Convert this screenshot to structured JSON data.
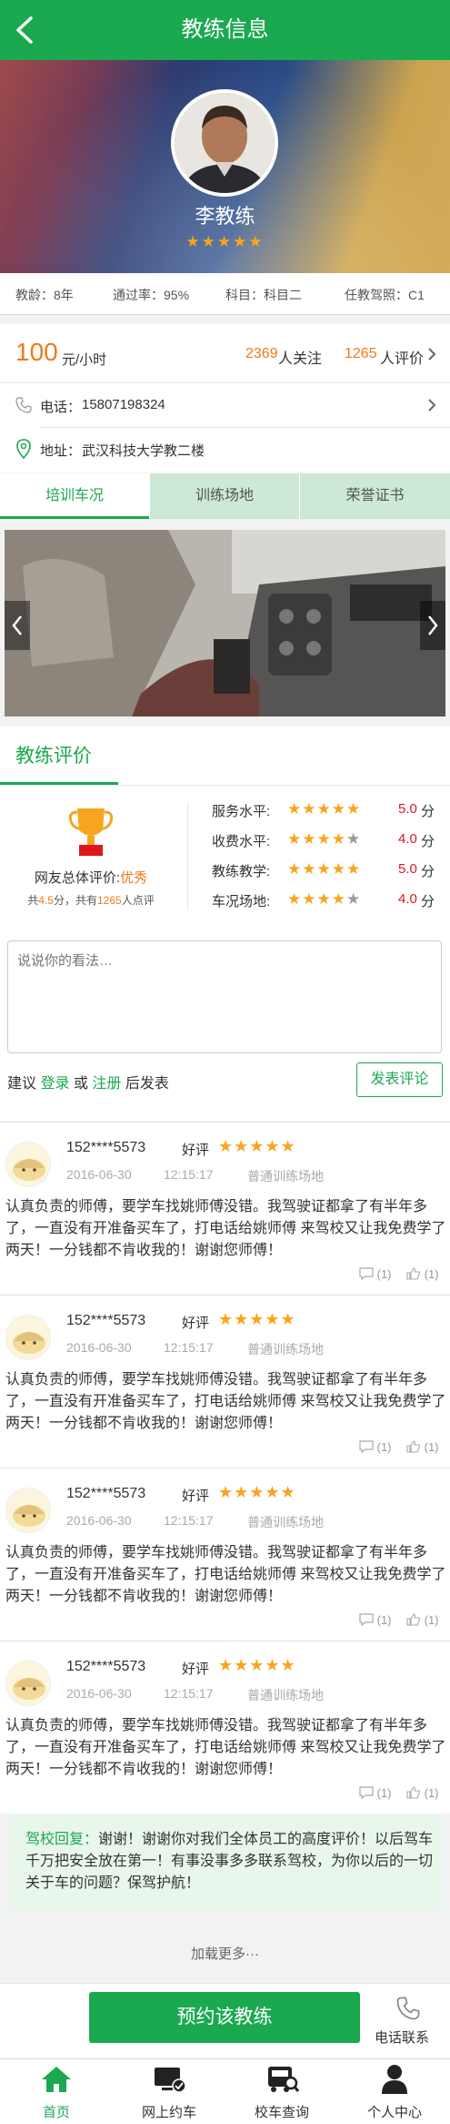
{
  "header": {
    "title": "教练信息"
  },
  "coach": {
    "name": "李教练",
    "stars": "★★★★★"
  },
  "stats": {
    "age": "教龄：8年",
    "pass_rate": "通过率：95%",
    "subject": "科目：科目二",
    "license": "任教驾照：C1"
  },
  "pricing": {
    "price": "100",
    "unit": "元/小时",
    "followers": "2369",
    "followers_label": "人关注",
    "evaluations": "1265",
    "evaluations_label": "人评价"
  },
  "contact": {
    "phone_label": "电话：",
    "phone": "15807198324",
    "address_label": "地址：",
    "address": "武汉科技大学教二楼"
  },
  "tabs": [
    "培训车况",
    "训练场地",
    "荣誉证书"
  ],
  "reviews_section": {
    "title": "教练评价",
    "overall_label": "网友总体评价:",
    "overall_value": "优秀",
    "summary_total": "共",
    "summary_score": "4.5",
    "summary_mid": "分，共有",
    "summary_count": "1265",
    "summary_end": "人点评",
    "scores": [
      {
        "label": "服务水平:",
        "stars": "★★★★★",
        "value": "5.0",
        "unit": "分",
        "filled": 5
      },
      {
        "label": "收费水平:",
        "stars": "★★★★★",
        "value": "4.0",
        "unit": "分",
        "filled": 4
      },
      {
        "label": "教练教学:",
        "stars": "★★★★★",
        "value": "5.0",
        "unit": "分",
        "filled": 5
      },
      {
        "label": "车况场地:",
        "stars": "★★★★★",
        "value": "4.0",
        "unit": "分",
        "filled": 4
      }
    ]
  },
  "comment_box": {
    "placeholder": "说说你的看法…",
    "hint_prefix": "建议",
    "login": "登录",
    "or": "或",
    "register": "注册",
    "hint_suffix": "后发表",
    "publish": "发表评论"
  },
  "reviews": [
    {
      "user": "152****5573",
      "tag": "好评",
      "stars": "★★★★★",
      "date": "2016-06-30",
      "time": "12:15:17",
      "site": "普通训练场地",
      "body": "认真负责的师傅，要学车找姚师傅没错。我驾驶证都拿了有半年多了，一直没有开准备买车了，打电话给姚师傅 来驾校又让我免费学了两天！一分钱都不肯收我的！谢谢您师傅！",
      "replies": "(1)",
      "likes": "(1)"
    },
    {
      "user": "152****5573",
      "tag": "好评",
      "stars": "★★★★★",
      "date": "2016-06-30",
      "time": "12:15:17",
      "site": "普通训练场地",
      "body": "认真负责的师傅，要学车找姚师傅没错。我驾驶证都拿了有半年多了，一直没有开准备买车了，打电话给姚师傅 来驾校又让我免费学了两天！一分钱都不肯收我的！谢谢您师傅！",
      "replies": "(1)",
      "likes": "(1)"
    },
    {
      "user": "152****5573",
      "tag": "好评",
      "stars": "★★★★★",
      "date": "2016-06-30",
      "time": "12:15:17",
      "site": "普通训练场地",
      "body": "认真负责的师傅，要学车找姚师傅没错。我驾驶证都拿了有半年多了，一直没有开准备买车了，打电话给姚师傅 来驾校又让我免费学了两天！一分钱都不肯收我的！谢谢您师傅！",
      "replies": "(1)",
      "likes": "(1)"
    },
    {
      "user": "152****5573",
      "tag": "好评",
      "stars": "★★★★★",
      "date": "2016-06-30",
      "time": "12:15:17",
      "site": "普通训练场地",
      "body": "认真负责的师傅，要学车找姚师傅没错。我驾驶证都拿了有半年多了，一直没有开准备买车了，打电话给姚师傅 来驾校又让我免费学了两天！一分钱都不肯收我的！谢谢您师傅！",
      "replies": "(1)",
      "likes": "(1)"
    }
  ],
  "school_reply": {
    "label": "驾校回复：",
    "text": "谢谢！谢谢你对我们全体员工的高度评价！以后驾车千万把安全放在第一！有事没事多多联系驾校，为你以后的一切关于车的问题？保驾护航！"
  },
  "load_more": "加载更多···",
  "reserve": {
    "button": "预约该教练",
    "phone": "电话联系"
  },
  "nav": [
    "首页",
    "网上约车",
    "校车查询",
    "个人中心"
  ],
  "colors": {
    "brand": "#1ba94f",
    "accent": "#f07a19",
    "star": "#f7a51c",
    "score": "#e0161b"
  }
}
